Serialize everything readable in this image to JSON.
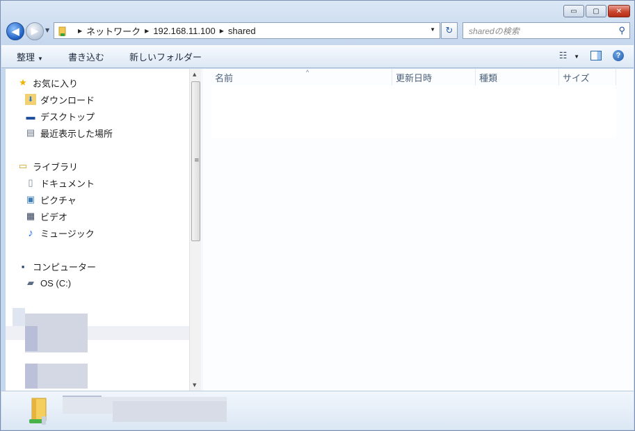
{
  "window": {
    "caption": {
      "minimize": "▭",
      "maximize": "▢",
      "close": "✕"
    }
  },
  "nav_buttons": {
    "back": "◀",
    "forward": "▶",
    "history": "▼"
  },
  "address": {
    "crumbs": [
      "ネットワーク",
      "192.168.11.100",
      "shared"
    ],
    "separator": "▶",
    "dropdown": "▼"
  },
  "refresh": {
    "glyph": "↻"
  },
  "search": {
    "placeholder": "sharedの検索",
    "icon_glyph": "⚲"
  },
  "commands": [
    {
      "label": "整理",
      "has_menu": true
    },
    {
      "label": "書き込む",
      "has_menu": false
    },
    {
      "label": "新しいフォルダー",
      "has_menu": false
    }
  ],
  "command_right": {
    "views_glyph": "☷",
    "views_dropdown": "▼",
    "help": "?"
  },
  "nav_pane": {
    "sections": [
      {
        "label": "お気に入り",
        "icon": "star-icon",
        "glyph": "★",
        "items": [
          {
            "label": "ダウンロード",
            "icon": "download-folder-icon",
            "glyph": "⬇"
          },
          {
            "label": "デスクトップ",
            "icon": "desktop-icon",
            "glyph": "▬"
          },
          {
            "label": "最近表示した場所",
            "icon": "recent-places-icon",
            "glyph": "▤"
          }
        ]
      },
      {
        "label": "ライブラリ",
        "icon": "library-icon",
        "glyph": "▭",
        "items": [
          {
            "label": "ドキュメント",
            "icon": "document-icon",
            "glyph": "▯"
          },
          {
            "label": "ピクチャ",
            "icon": "picture-icon",
            "glyph": "▣"
          },
          {
            "label": "ビデオ",
            "icon": "video-icon",
            "glyph": "▦"
          },
          {
            "label": "ミュージック",
            "icon": "music-icon",
            "glyph": "♪"
          }
        ]
      },
      {
        "label": "コンピューター",
        "icon": "computer-icon",
        "glyph": "▪",
        "items": [
          {
            "label": "OS (C:)",
            "icon": "drive-icon",
            "glyph": "▰"
          }
        ]
      }
    ]
  },
  "scrollbar": {
    "up": "▲",
    "down": "▼",
    "grip": "≡"
  },
  "columns": {
    "sort_caret": "^",
    "items": [
      {
        "label": "名前"
      },
      {
        "label": "更新日時"
      },
      {
        "label": "種類"
      },
      {
        "label": "サイズ"
      }
    ]
  },
  "colors": {
    "accent": "#1c5fc0",
    "close_button": "#c9462f",
    "content_bg": "#fcfdfe"
  }
}
